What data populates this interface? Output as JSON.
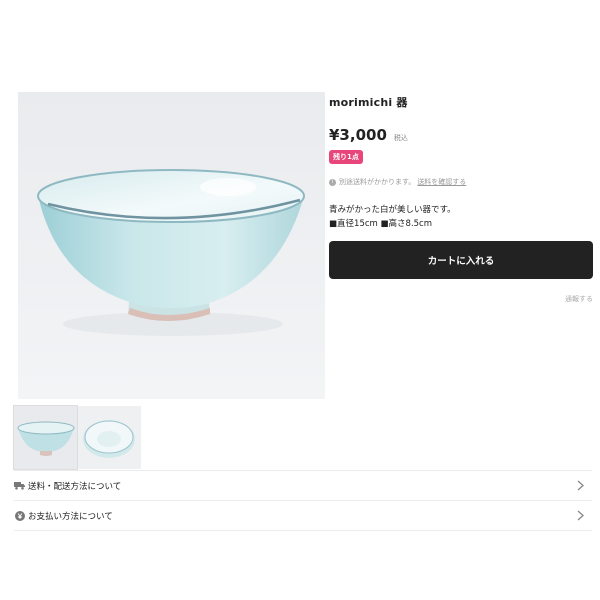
{
  "product": {
    "title": "morimichi 器",
    "price": "¥3,000",
    "tax_label": "税込",
    "stock_badge": "残り1点",
    "shipping_note": "別途送料がかかります。",
    "shipping_link": "送料を確認する",
    "description_line1": "青みがかった白が美しい器です。",
    "description_line2": "■直径15cm ■高さ8.5cm",
    "cart_button": "カートに入れる",
    "report_link": "通報する"
  },
  "thumbnails": [
    {
      "name": "side-view",
      "active": true
    },
    {
      "name": "top-view",
      "active": false
    }
  ],
  "accordion": {
    "shipping_label": "送料・配送方法について",
    "payment_label": "お支払い方法について"
  }
}
